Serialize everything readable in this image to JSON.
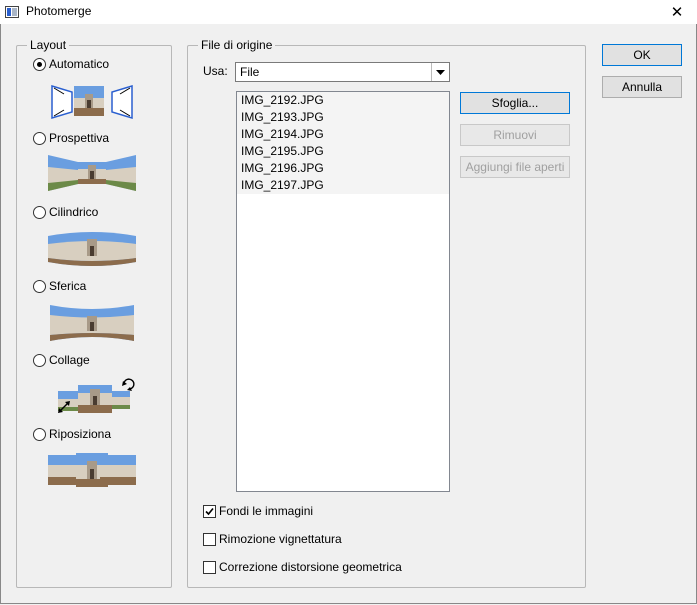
{
  "window": {
    "title": "Photomerge",
    "close_glyph": "✕"
  },
  "layout_group": {
    "legend": "Layout",
    "options": [
      {
        "label": "Automatico",
        "checked": true
      },
      {
        "label": "Prospettiva",
        "checked": false
      },
      {
        "label": "Cilindrico",
        "checked": false
      },
      {
        "label": "Sferica",
        "checked": false
      },
      {
        "label": "Collage",
        "checked": false
      },
      {
        "label": "Riposiziona",
        "checked": false
      }
    ]
  },
  "source_group": {
    "legend": "File di origine",
    "use_label": "Usa:",
    "use_value": "File",
    "files": [
      "IMG_2192.JPG",
      "IMG_2193.JPG",
      "IMG_2194.JPG",
      "IMG_2195.JPG",
      "IMG_2196.JPG",
      "IMG_2197.JPG"
    ],
    "browse_label": "Sfoglia...",
    "remove_label": "Rimuovi",
    "add_open_label": "Aggiungi file aperti",
    "options": [
      {
        "label": "Fondi le immagini",
        "checked": true
      },
      {
        "label": "Rimozione vignettatura",
        "checked": false
      },
      {
        "label": "Correzione distorsione geometrica",
        "checked": false
      }
    ]
  },
  "dialog_buttons": {
    "ok_label": "OK",
    "cancel_label": "Annulla"
  },
  "colors": {
    "sky": "#5b8fd6",
    "building": "#d8cfc0",
    "ground": "#9a7a5a",
    "grass": "#6c8a48",
    "accent_blue": "#2a5fcf"
  }
}
